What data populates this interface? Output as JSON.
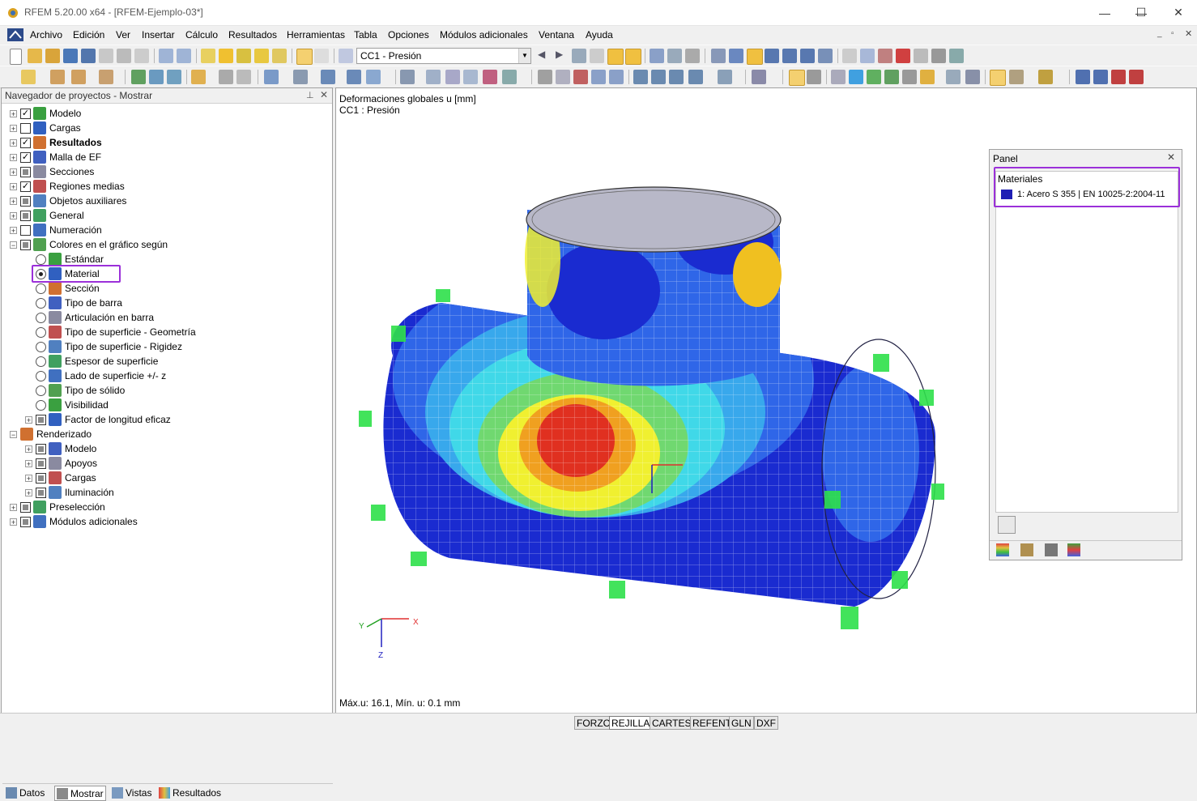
{
  "window": {
    "title": "RFEM 5.20.00 x64 - [RFEM-Ejemplo-03*]",
    "minimize": "—",
    "maximize": "☐",
    "close": "✕"
  },
  "menu": [
    "Archivo",
    "Edición",
    "Ver",
    "Insertar",
    "Cálculo",
    "Resultados",
    "Herramientas",
    "Tabla",
    "Opciones",
    "Módulos adicionales",
    "Ventana",
    "Ayuda"
  ],
  "toolbar": {
    "load_case": "CC1 - Presión"
  },
  "navigator": {
    "title": "Navegador de proyectos - Mostrar",
    "pin_icon": "pin-icon",
    "close_icon": "close-icon",
    "items": [
      {
        "label": "Modelo",
        "level": 0,
        "check": "checked",
        "expander": "+"
      },
      {
        "label": "Cargas",
        "level": 0,
        "check": "unchecked",
        "expander": "+"
      },
      {
        "label": "Resultados",
        "level": 0,
        "check": "checked",
        "expander": "+",
        "bold": true
      },
      {
        "label": "Malla de EF",
        "level": 0,
        "check": "checked",
        "expander": "+"
      },
      {
        "label": "Secciones",
        "level": 0,
        "check": "partial",
        "expander": "+"
      },
      {
        "label": "Regiones medias",
        "level": 0,
        "check": "checked",
        "expander": "+"
      },
      {
        "label": "Objetos auxiliares",
        "level": 0,
        "check": "partial",
        "expander": "+"
      },
      {
        "label": "General",
        "level": 0,
        "check": "partial",
        "expander": "+"
      },
      {
        "label": "Numeración",
        "level": 0,
        "check": "unchecked",
        "expander": "+"
      },
      {
        "label": "Colores en el gráfico según",
        "level": 0,
        "check": "partial",
        "expander": "−"
      },
      {
        "label": "Estándar",
        "level": 1,
        "radio": "off"
      },
      {
        "label": "Material",
        "level": 1,
        "radio": "on"
      },
      {
        "label": "Sección",
        "level": 1,
        "radio": "off"
      },
      {
        "label": "Tipo de barra",
        "level": 1,
        "radio": "off"
      },
      {
        "label": "Articulación en barra",
        "level": 1,
        "radio": "off"
      },
      {
        "label": "Tipo de superficie - Geometría",
        "level": 1,
        "radio": "off"
      },
      {
        "label": "Tipo de superficie - Rigidez",
        "level": 1,
        "radio": "off"
      },
      {
        "label": "Espesor de superficie",
        "level": 1,
        "radio": "off"
      },
      {
        "label": "Lado de superficie +/- z",
        "level": 1,
        "radio": "off"
      },
      {
        "label": "Tipo de sólido",
        "level": 1,
        "radio": "off"
      },
      {
        "label": "Visibilidad",
        "level": 1,
        "radio": "off"
      },
      {
        "label": "Factor de longitud eficaz",
        "level": 1,
        "check": "partial",
        "expander": "+"
      },
      {
        "label": "Renderizado",
        "level": 0,
        "expander": "−",
        "nocheck": true
      },
      {
        "label": "Modelo",
        "level": 1,
        "check": "partial",
        "expander": "+"
      },
      {
        "label": "Apoyos",
        "level": 1,
        "check": "partial",
        "expander": "+"
      },
      {
        "label": "Cargas",
        "level": 1,
        "check": "partial",
        "expander": "+"
      },
      {
        "label": "Iluminación",
        "level": 1,
        "check": "partial",
        "expander": "+"
      },
      {
        "label": "Preselección",
        "level": 0,
        "check": "partial",
        "expander": "+"
      },
      {
        "label": "Módulos adicionales",
        "level": 0,
        "check": "partial",
        "expander": "+"
      }
    ],
    "tabs": [
      "Datos",
      "Mostrar",
      "Vistas",
      "Resultados"
    ]
  },
  "viewport": {
    "header_line1": "Deformaciones globales u [mm]",
    "header_line2": "CC1 : Presión",
    "footer": "Máx.u: 16.1, Mín. u: 0.1 mm",
    "axis_x": "X",
    "axis_y": "Y",
    "axis_z": "Z"
  },
  "panel": {
    "title": "Panel",
    "section": "Materiales",
    "material": "1: Acero S 355 | EN 10025-2:2004-11",
    "material_color": "#1f1fb4"
  },
  "statusbar": [
    "FORZC",
    "REJILLA",
    "CARTES",
    "REFENT",
    "GLN",
    "DXF"
  ],
  "colors": {
    "highlight": "#9b30d9"
  }
}
